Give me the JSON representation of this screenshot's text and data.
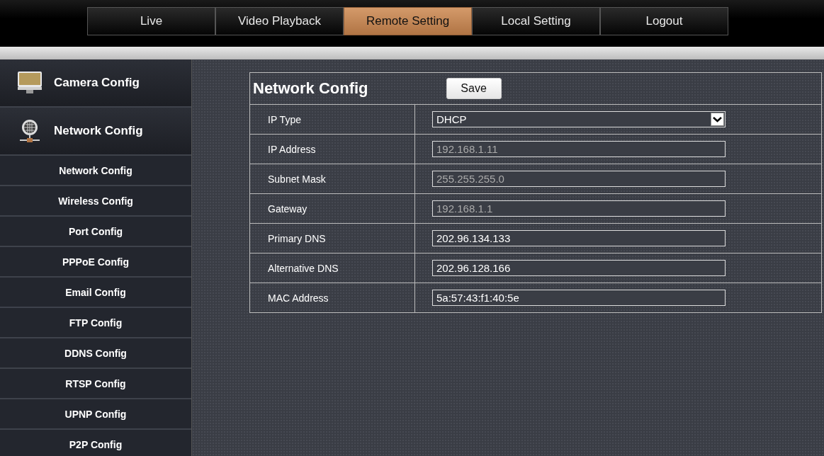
{
  "tabs": [
    {
      "label": "Live",
      "selected": false
    },
    {
      "label": "Video Playback",
      "selected": false
    },
    {
      "label": "Remote Setting",
      "selected": true
    },
    {
      "label": "Local Setting",
      "selected": false
    },
    {
      "label": "Logout",
      "selected": false
    }
  ],
  "sidebar": {
    "groups": [
      {
        "label": "Camera Config"
      },
      {
        "label": "Network Config",
        "children": [
          {
            "label": "Network Config"
          },
          {
            "label": "Wireless Config"
          },
          {
            "label": "Port Config"
          },
          {
            "label": "PPPoE Config"
          },
          {
            "label": "Email Config"
          },
          {
            "label": "FTP Config"
          },
          {
            "label": "DDNS Config"
          },
          {
            "label": "RTSP Config"
          },
          {
            "label": "UPNP Config"
          },
          {
            "label": "P2P Config"
          }
        ]
      }
    ]
  },
  "panel": {
    "title": "Network Config",
    "save_button": "Save",
    "fields": [
      {
        "label": "IP Type",
        "kind": "select",
        "value": "DHCP",
        "disabled": false
      },
      {
        "label": "IP Address",
        "kind": "text",
        "value": "192.168.1.11",
        "disabled": true
      },
      {
        "label": "Subnet Mask",
        "kind": "text",
        "value": "255.255.255.0",
        "disabled": true
      },
      {
        "label": "Gateway",
        "kind": "text",
        "value": "192.168.1.1",
        "disabled": true
      },
      {
        "label": "Primary DNS",
        "kind": "text",
        "value": "202.96.134.133",
        "disabled": false
      },
      {
        "label": "Alternative DNS",
        "kind": "text",
        "value": "202.96.128.166",
        "disabled": false
      },
      {
        "label": "MAC Address",
        "kind": "text",
        "value": "5a:57:43:f1:40:5e",
        "disabled": false
      }
    ]
  }
}
